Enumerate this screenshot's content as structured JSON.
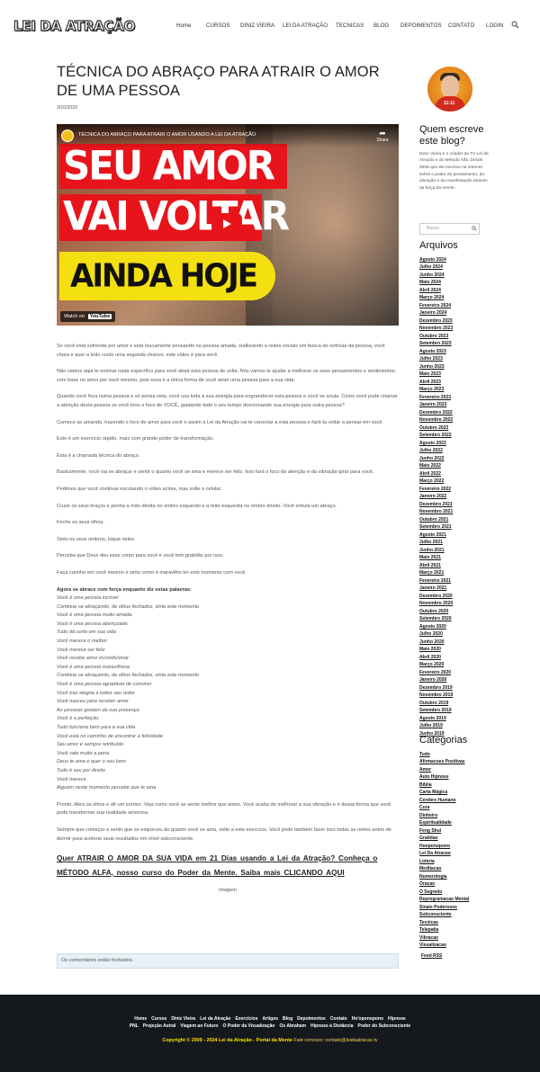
{
  "header": {
    "logo": "LEI DA ATRAÇÃO",
    "nav": [
      "Home",
      "CURSOS",
      "DINIZ VIEIRA",
      "LEI DA ATRAÇÃO",
      "TECNICAS",
      "BLOG",
      "DEPOIMENTOS",
      "CONTATO",
      "LOGIN"
    ],
    "search_icon": "search-icon"
  },
  "post": {
    "title": "TÉCNICA DO ABRAÇO PARA ATRAIR O AMOR DE UMA PESSOA",
    "date": "3/10/2020",
    "video": {
      "title": "TÉCNICA DO ABRAÇO PARA ATRAIR O AMOR USANDO A LEI DA ATRAÇÃO",
      "share": "Share",
      "line1": "SEU AMOR",
      "line2": "VAI VOLTAR",
      "line3": "AINDA HOJE",
      "watch_on": "Watch on",
      "youtube": "YouTube"
    },
    "paragraphs": [
      "Se você está sofrendo por amor e está loucamente pensando na pessoa amada, stalkeando a redes sociais em busca de notícias da pessoa, você chora e quer a todo custo uma segunda chance, este vídeo é para você.",
      "Não vamos aqui te ensinar nada específico para você atrair esta pessoa de volta. Nós vamos te ajudar a melhorar os seus pensamentos e sentimentos, com base no amor por você mesmo, pois essa é a única forma de você atrair uma pessoa para a sua vida.",
      "Quando você foca numa pessoa e só pensa nela, você usa toda a sua energia para engrandecer esta pessoa e você se anula. Como você pode chamar a atenção desta pessoa se você tirou o foco de VOCÊ, gastando todo o seu tempo direcionando sua energia para outra pessoa?",
      "Comece se amando, trazendo o foco de amor para você e assim a Lei da Atração vai te conectar a esta pessoa e fazê-la voltar a pensar em você.",
      "Este é um exercício rápido, mais com grande poder de transformação.",
      "Esta é a chamada técnica do abraço.",
      "Basicamente, você vai se abraçar e sentir o quanto você se ama e merece ser feliz. Isso fará o foco da atenção e da vibração girar para você.",
      "Pedimos que você continue escutando o vídeo acima, mas solte o celular.",
      "Cruze os seus braços e ponha a mão direita no ombro esquerdo e a mão esquerda no ombro direito. Você simula um abraço.",
      "Feche os seus olhos.",
      "Sinto os seus ombros, toque neles.",
      "Perceba que Deus deu esse corpo para você e você tem gratidão por isso.",
      "Faça carinho em você mesmo e sinto como é maravilho ter este momento com você."
    ],
    "poem_heading": "Agora se abrace com força enquanto diz estas palavras:",
    "poem": [
      "Você é uma pessoa incrível",
      "Continue se abraçando, de olhos fechados, sinta este momento",
      "Você é uma pessoa muito amada.",
      "Você é uma pessoa abençoada",
      "Tudo dá certo em sua vida",
      "Você merece o melhor",
      "Você merece ser feliz",
      "Você recebe amor incondicional",
      "Você é uma pessoa maravilhosa",
      "Continue se abraçando, de olhos fechados, sinta este momento",
      "Você é uma pessoa agradável de conviver",
      "Você traz alegria a todos seu redor",
      "Você nasceu para receber amor",
      "As pessoas gostam da sua presença",
      "Você é a perfeição",
      "Tudo funciona bem para a sua vida",
      "Você está no caminho de encontrar a felicidade",
      "Seu amor é sempre retribuído",
      "Você vale muito a pena",
      "Deus te ama e quer o seu bem",
      "Tudo é seu por direito",
      "Você merece",
      "Alguém neste momento percebe que te ama"
    ],
    "after": [
      "Pronto. Abra os olhos e dê um sorriso. Veja como você se sente melhor que antes. Você acaba de melhorar a sua vibração e é dessa forma que você pode transformar sua realidade amorosa.",
      "Sempre que começar a sentir que se esqueceu do quanto você se ama, volte a este exercício. Você pode também fazer isso todas as noites antes de dormir para acelerar seus resultados em nível subconsciente."
    ],
    "cta": "Quer ATRAIR O AMOR DA SUA VIDA em 21 Dias usando a Lei da Atração? Conheça o MÉTODO ALFA, nosso curso do Poder da Mente. Saiba mais CLICANDO AQUI",
    "image_alt": "imagem",
    "comments_closed": "Os comentários estão fechados."
  },
  "sidebar": {
    "about_heading": "Quem escreve este blog?",
    "about_text": "Diniz Vieira é o criador da TV Lei da Atração e do Método Alfa. Desde 2009 que ele escreve na internet sobre o poder do pensamento, da vibração e da manifestação através da força da mente.",
    "avatar_text": "11:11",
    "search_placeholder": "Busca",
    "archives_heading": "Arquivos",
    "archives": [
      "Agosto 2024",
      "Julho 2024",
      "Junho 2024",
      "Maio 2024",
      "Abril 2024",
      "Março 2024",
      "Fevereiro 2024",
      "Janeiro 2024",
      "Dezembro 2023",
      "Novembro 2023",
      "Outubro 2023",
      "Setembro 2023",
      "Agosto 2023",
      "Julho 2023",
      "Junho 2023",
      "Maio 2023",
      "Abril 2023",
      "Março 2023",
      "Fevereiro 2023",
      "Janeiro 2023",
      "Dezembro 2022",
      "Novembro 2022",
      "Outubro 2022",
      "Setembro 2022",
      "Agosto 2022",
      "Julho 2022",
      "Junho 2022",
      "Maio 2022",
      "Abril 2022",
      "Março 2022",
      "Fevereiro 2022",
      "Janeiro 2022",
      "Dezembro 2021",
      "Novembro 2021",
      "Outubro 2021",
      "Setembro 2021",
      "Agosto 2021",
      "Julho 2021",
      "Junho 2021",
      "Maio 2021",
      "Abril 2021",
      "Março 2021",
      "Fevereiro 2021",
      "Janeiro 2021",
      "Dezembro 2020",
      "Novembro 2020",
      "Outubro 2020",
      "Setembro 2020",
      "Agosto 2020",
      "Julho 2020",
      "Junho 2020",
      "Maio 2020",
      "Abril 2020",
      "Março 2020",
      "Fevereiro 2020",
      "Janeiro 2020",
      "Dezembro 2019",
      "Novembro 2019",
      "Outubro 2019",
      "Setembro 2019",
      "Agosto 2019",
      "Julho 2019",
      "Junho 2019"
    ],
    "categories_heading": "Categorias",
    "categories": [
      "Tudo",
      "Afirmacoes Positivas",
      "Amor",
      "Auto Hipnose",
      "Bíblia",
      "Carta Mágica",
      "Cerebro Humano",
      "Cura",
      "Dinheiro",
      "Espiritualidade",
      "Feng Shui",
      "Gratidao",
      "Hooponopono",
      "Lei Da Atracao",
      "Loteria",
      "Meditacao",
      "Numerologia",
      "Oracao",
      "O Segredo",
      "Reprogramacao Mental",
      "Sinais Poderosos",
      "Subconsciente",
      "Tecnicas",
      "Telepatia",
      "Vibracao",
      "Visualizacao"
    ],
    "feed": "Feed RSS"
  },
  "footer": {
    "row1": [
      "Home",
      "Cursos",
      "Diniz Vieira",
      "Lei da Atração",
      "Exercícios",
      "Artigos",
      "Blog",
      "Depoimentos",
      "Contato",
      "Ho'oponopono",
      "Hipnose"
    ],
    "row2": [
      "PNL",
      "Projeção Astral",
      "Viagem ao Futuro",
      "O Poder da Visualização",
      "Os Abraham",
      "Hipnose à Distância",
      "Poder do Subconsciente"
    ],
    "copyright": "Copyright © 2009 - 2024 Lei da Atração - Portal da Mente",
    "contact": "Fale conosco: contato@leidaatracao.tv"
  },
  "colors": {
    "accent_red": "#e8141b",
    "accent_yellow": "#f4e010",
    "footer_bg": "#15181c",
    "copyright": "#ffe000"
  }
}
